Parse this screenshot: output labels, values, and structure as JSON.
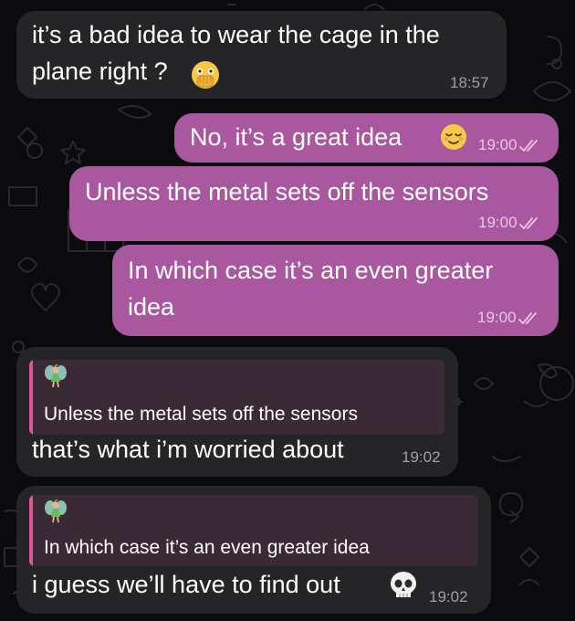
{
  "messages": [
    {
      "direction": "incoming",
      "lines": [
        "it’s a bad idea to wear the cage in the",
        "plane right ?"
      ],
      "emoji": "face-with-open-eyes-and-hand-over-mouth",
      "time": "18:57"
    },
    {
      "direction": "outgoing",
      "lines": [
        "No, it’s a great idea"
      ],
      "emoji": "relieved-face",
      "time": "19:00",
      "status": "read"
    },
    {
      "direction": "outgoing",
      "lines": [
        "Unless the metal sets off the sensors"
      ],
      "time": "19:00",
      "status": "read"
    },
    {
      "direction": "outgoing",
      "lines": [
        "In which case it’s an even greater",
        "idea"
      ],
      "time": "19:00",
      "status": "read"
    },
    {
      "direction": "incoming",
      "reply": {
        "sender_icon": "fairy-emoji",
        "text": "Unless the metal sets off the sensors"
      },
      "lines": [
        "that’s what i’m worried about"
      ],
      "time": "19:02"
    },
    {
      "direction": "incoming",
      "reply": {
        "sender_icon": "fairy-emoji",
        "text": "In which case it’s an even greater idea"
      },
      "lines": [
        "i guess we’ll have to find out"
      ],
      "emoji": "skull",
      "time": "19:02"
    }
  ],
  "colors": {
    "background": "#0b0b0d",
    "incoming_bubble": "#252527",
    "outgoing_bubble": "#a9589f",
    "reply_accent": "#e2549a"
  }
}
